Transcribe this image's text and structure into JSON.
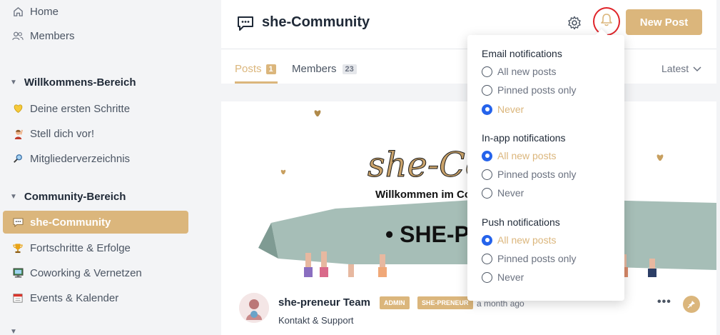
{
  "sidebar": {
    "top_items": [
      {
        "label": "Home",
        "icon": "home-icon"
      },
      {
        "label": "Members",
        "icon": "members-icon"
      }
    ],
    "sections": [
      {
        "title": "Willkommens-Bereich",
        "items": [
          {
            "label": "Deine ersten Schritte",
            "icon": "yellow-heart-icon"
          },
          {
            "label": "Stell dich vor!",
            "icon": "raising-hand-icon"
          },
          {
            "label": "Mitgliederverzeichnis",
            "icon": "magnifier-icon"
          }
        ]
      },
      {
        "title": "Community-Bereich",
        "items": [
          {
            "label": "she-Community",
            "icon": "speech-bubble-icon",
            "active": true
          },
          {
            "label": "Fortschritte & Erfolge",
            "icon": "trophy-icon"
          },
          {
            "label": "Coworking & Vernetzen",
            "icon": "desktop-icon"
          },
          {
            "label": "Events & Kalender",
            "icon": "calendar-icon"
          }
        ]
      }
    ]
  },
  "header": {
    "title": "she-Community",
    "new_post_label": "New Post",
    "tabs": [
      {
        "label": "Posts",
        "count": "1",
        "active": true
      },
      {
        "label": "Members",
        "count": "23"
      }
    ],
    "sort_label": "Latest"
  },
  "banner": {
    "script_text": "she-Com",
    "welcome_text": "Willkommen im Co",
    "ribbon_text": "• SHE-P"
  },
  "post": {
    "author": "she-preneur Team",
    "badges": [
      "ADMIN",
      "SHE-PRENEUR"
    ],
    "time": "a month ago",
    "subtitle": "Kontakt & Support"
  },
  "notifications": {
    "groups": [
      {
        "title": "Email notifications",
        "options": [
          "All new posts",
          "Pinned posts only",
          "Never"
        ],
        "selected": 2
      },
      {
        "title": "In-app notifications",
        "options": [
          "All new posts",
          "Pinned posts only",
          "Never"
        ],
        "selected": 0
      },
      {
        "title": "Push notifications",
        "options": [
          "All new posts",
          "Pinned posts only",
          "Never"
        ],
        "selected": 0
      }
    ]
  },
  "colors": {
    "accent": "#dbb67c",
    "radio_selected": "#2563eb",
    "annotation": "#e0242a"
  }
}
